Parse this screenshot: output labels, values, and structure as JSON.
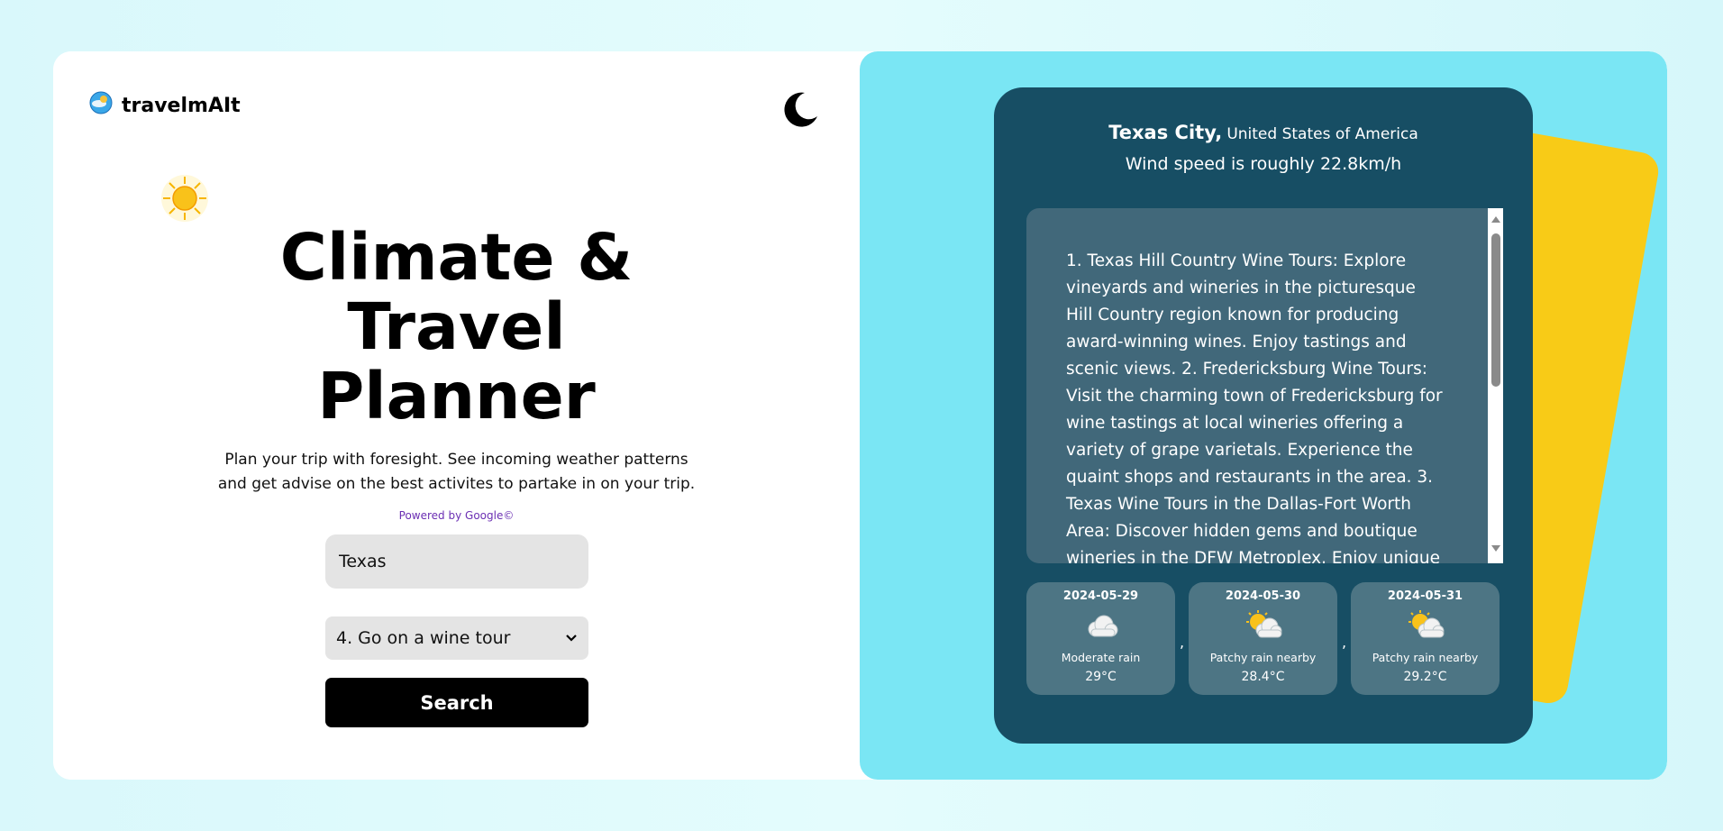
{
  "app": {
    "name": "travelmAIt"
  },
  "hero": {
    "title_line1": "Climate &",
    "title_line2": "Travel",
    "title_line3": "Planner",
    "subtitle": "Plan your trip with foresight. See incoming weather patterns and get advise on the best activites to partake in on your trip.",
    "powered_by": "Powered by Google©"
  },
  "form": {
    "location_value": "Texas",
    "activity_selected": "4. Go on a wine tour",
    "search_label": "Search"
  },
  "result": {
    "city": "Texas City,",
    "country": "United States of America",
    "wind": "Wind speed is roughly 22.8km/h",
    "recommendations": "1. Texas Hill Country Wine Tours: Explore vineyards and wineries in the picturesque Hill Country region known for producing award-winning wines. Enjoy tastings and scenic views. 2. Fredericksburg Wine Tours: Visit the charming town of Fredericksburg for wine tastings at local wineries offering a variety of grape varietals. Experience the quaint shops and restaurants in the area. 3. Texas Wine Tours in the Dallas-Fort Worth Area: Discover hidden gems and boutique wineries in the DFW Metroplex. Enjoy unique wine tastings and"
  },
  "forecast": [
    {
      "date": "2024-05-29",
      "icon": "cloud-icon",
      "condition": "Moderate rain",
      "temp": "29°C"
    },
    {
      "date": "2024-05-30",
      "icon": "partly-cloudy-icon",
      "condition": "Patchy rain nearby",
      "temp": "28.4°C"
    },
    {
      "date": "2024-05-31",
      "icon": "partly-cloudy-icon",
      "condition": "Patchy rain nearby",
      "temp": "29.2°C"
    }
  ],
  "separators": {
    "comma1": ",",
    "comma2": ","
  },
  "colors": {
    "right_bg": "#7ae6f4",
    "panel": "#174e64",
    "accent_card": "#f8cb17",
    "forecast_card": "#4d7584"
  }
}
